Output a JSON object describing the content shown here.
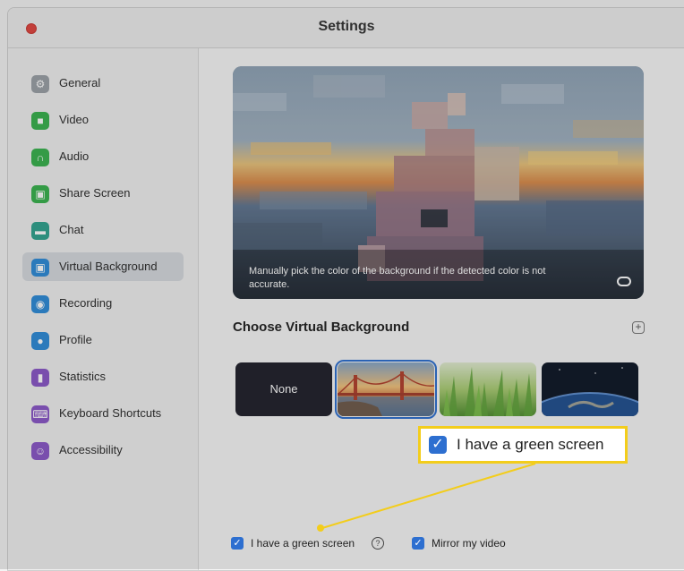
{
  "window": {
    "title": "Settings"
  },
  "sidebar": {
    "items": [
      {
        "label": "General",
        "icon": "gear-icon",
        "color": "#9aa0a6"
      },
      {
        "label": "Video",
        "icon": "video-camera-icon",
        "color": "#37b24d"
      },
      {
        "label": "Audio",
        "icon": "headphones-icon",
        "color": "#37b24d"
      },
      {
        "label": "Share Screen",
        "icon": "share-screen-icon",
        "color": "#37b24d"
      },
      {
        "label": "Chat",
        "icon": "chat-bubble-icon",
        "color": "#2fa38e"
      },
      {
        "label": "Virtual Background",
        "icon": "virtual-background-icon",
        "color": "#2d8bd8",
        "active": true
      },
      {
        "label": "Recording",
        "icon": "record-icon",
        "color": "#2d8bd8"
      },
      {
        "label": "Profile",
        "icon": "person-icon",
        "color": "#2d8bd8"
      },
      {
        "label": "Statistics",
        "icon": "bar-chart-icon",
        "color": "#8a56c7"
      },
      {
        "label": "Keyboard Shortcuts",
        "icon": "keyboard-icon",
        "color": "#8a56c7"
      },
      {
        "label": "Accessibility",
        "icon": "accessibility-icon",
        "color": "#8a56c7"
      }
    ]
  },
  "preview": {
    "caption": "Manually pick the color of the background if the detected color is not accurate."
  },
  "virtual_background": {
    "section_title": "Choose Virtual Background",
    "add_icon": "plus-icon",
    "options": [
      {
        "label": "None"
      },
      {
        "name": "golden-gate-bridge",
        "selected": true
      },
      {
        "name": "grass"
      },
      {
        "name": "earth-from-space"
      }
    ]
  },
  "callout": {
    "label": "I have a green screen",
    "checked": true
  },
  "options": {
    "green_screen_label": "I have a green screen",
    "green_screen_checked": true,
    "mirror_label": "Mirror my video",
    "mirror_checked": true
  },
  "colors": {
    "accent": "#2d6fd0",
    "highlight": "#f3cd1b"
  }
}
